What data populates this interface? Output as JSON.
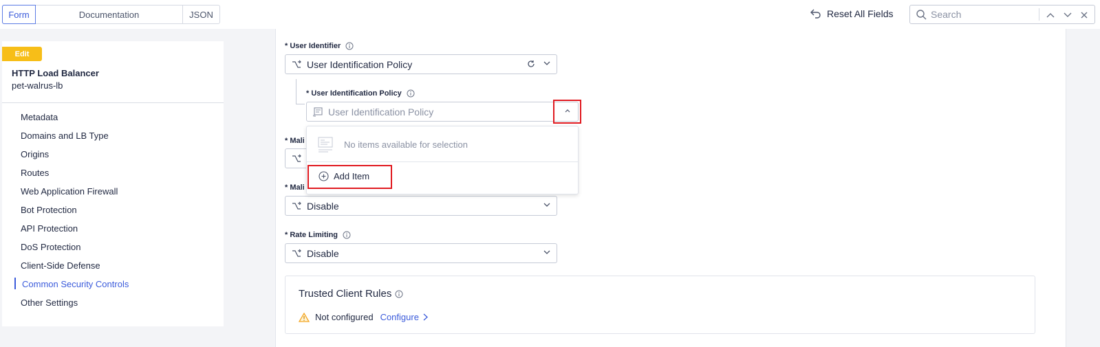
{
  "topbar": {
    "tabs": [
      {
        "label": "Form",
        "active": true
      },
      {
        "label": "Documentation",
        "active": false
      },
      {
        "label": "JSON",
        "active": false
      }
    ],
    "reset_label": "Reset All Fields",
    "search_placeholder": "Search"
  },
  "sidebar": {
    "badge": "Edit",
    "object_type": "HTTP Load Balancer",
    "object_name": "pet-walrus-lb",
    "items": [
      {
        "label": "Metadata",
        "active": false
      },
      {
        "label": "Domains and LB Type",
        "active": false
      },
      {
        "label": "Origins",
        "active": false
      },
      {
        "label": "Routes",
        "active": false
      },
      {
        "label": "Web Application Firewall",
        "active": false
      },
      {
        "label": "Bot Protection",
        "active": false
      },
      {
        "label": "API Protection",
        "active": false
      },
      {
        "label": "DoS Protection",
        "active": false
      },
      {
        "label": "Client-Side Defense",
        "active": false
      },
      {
        "label": "Common Security Controls",
        "active": true
      },
      {
        "label": "Other Settings",
        "active": false
      }
    ]
  },
  "form": {
    "user_identifier": {
      "label": "* User Identifier",
      "value": "User Identification Policy"
    },
    "user_identification_policy": {
      "label": "* User Identification Policy",
      "placeholder": "User Identification Policy"
    },
    "malicious_1": {
      "label": "* Mali"
    },
    "malicious_2": {
      "label": "* Mali",
      "value": "Disable"
    },
    "rate_limiting": {
      "label": "* Rate Limiting",
      "value": "Disable"
    },
    "dropdown": {
      "empty_text": "No items available for selection",
      "add_label": "Add Item"
    },
    "trusted_client_rules": {
      "title": "Trusted Client Rules",
      "status": "Not configured",
      "action": "Configure"
    }
  },
  "colors": {
    "accent": "#3b5bdb",
    "badge": "#f7be18",
    "highlight": "#e0191f",
    "warning": "#f5a623"
  }
}
